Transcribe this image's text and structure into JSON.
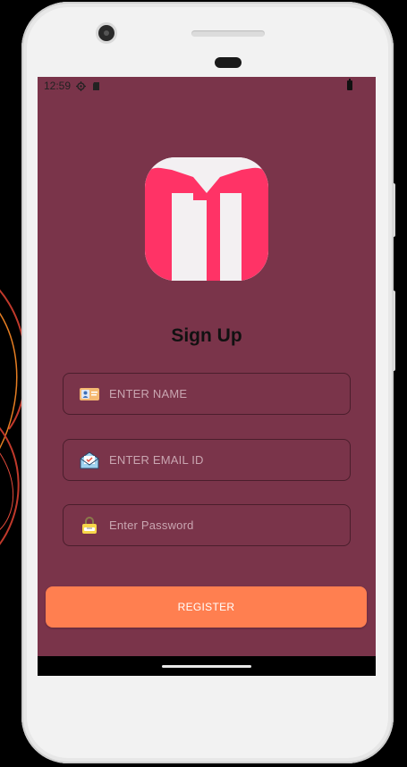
{
  "status_bar": {
    "time": "12:59"
  },
  "signup": {
    "title": "Sign Up",
    "name_placeholder": "ENTER NAME",
    "email_placeholder": "ENTER EMAIL ID",
    "password_placeholder": "Enter Password",
    "register_label": "REGISTER"
  },
  "colors": {
    "screen_background": "#7a344a",
    "register_button": "#ff7f50",
    "logo_pink": "#ff3366",
    "logo_tile": "#f3f0f2"
  },
  "icons": {
    "status": [
      "settings-icon",
      "sd-card-icon",
      "battery-icon"
    ],
    "name_field": "id-card-icon",
    "email_field": "envelope-icon",
    "password_field": "lock-icon"
  }
}
